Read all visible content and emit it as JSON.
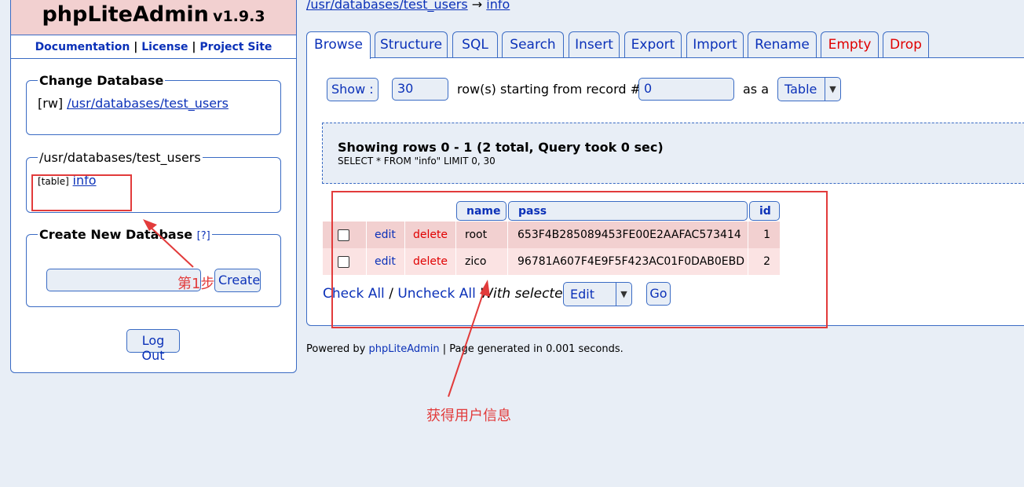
{
  "sidebar": {
    "app_name": "phpLiteAdmin",
    "version": "v1.9.3",
    "links": {
      "documentation": "Documentation",
      "sep1": "|",
      "license": "License",
      "sep2": "|",
      "project_site": "Project Site"
    },
    "change_db": {
      "legend": "Change Database",
      "mode": "[rw]",
      "db_path": "/usr/databases/test_users"
    },
    "tables": {
      "legend": "/usr/databases/test_users",
      "table_tag": "[table]",
      "table_name": "info"
    },
    "create_db": {
      "legend": "Create New Database",
      "help": "[?]",
      "input_value": "",
      "create_label": "Create"
    },
    "logout_label": "Log Out"
  },
  "breadcrumb": {
    "db": "/usr/databases/test_users",
    "arrow": "→",
    "table": "info"
  },
  "tabs": [
    {
      "label": "Browse",
      "active": true
    },
    {
      "label": "Structure"
    },
    {
      "label": "SQL"
    },
    {
      "label": "Search"
    },
    {
      "label": "Insert"
    },
    {
      "label": "Export"
    },
    {
      "label": "Import"
    },
    {
      "label": "Rename"
    },
    {
      "label": "Empty",
      "color": "#e00000"
    },
    {
      "label": "Drop",
      "color": "#e00000"
    }
  ],
  "browse": {
    "show_label": "Show :",
    "rows_value": "30",
    "rows_text": "row(s) starting from record #",
    "start_value": "0",
    "as_a_text": "as a",
    "view_value": "Table"
  },
  "query": {
    "title": "Showing rows 0 - 1 (2 total, Query took 0 sec)",
    "sql": "SELECT * FROM \"info\" LIMIT 0, 30"
  },
  "results": {
    "columns": [
      "name",
      "pass",
      "id"
    ],
    "edit_label": "edit",
    "delete_label": "delete",
    "rows": [
      {
        "name": "root",
        "pass": "653F4B285089453FE00E2AAFAC573414",
        "id": "1"
      },
      {
        "name": "zico",
        "pass": "96781A607F4E9F5F423AC01F0DAB0EBD",
        "id": "2"
      }
    ],
    "check_all": "Check All",
    "slash": "/",
    "uncheck_all": "Uncheck All",
    "with_selected": "With selected:",
    "action_value": "Edit",
    "go_label": "Go"
  },
  "footer": {
    "powered_by": "Powered by",
    "link": "phpLiteAdmin",
    "rest": "| Page generated in 0.001 seconds."
  },
  "annotations": {
    "step1": "第1步",
    "get_info": "获得用户信息",
    "color": "#e23b3b"
  },
  "colors": {
    "background": "#e8eef6",
    "border": "#3a6bc4",
    "link": "#0b31b8",
    "danger": "#e00000",
    "row_dark": "#f2d0d0",
    "row_light": "#fbe3e3"
  }
}
